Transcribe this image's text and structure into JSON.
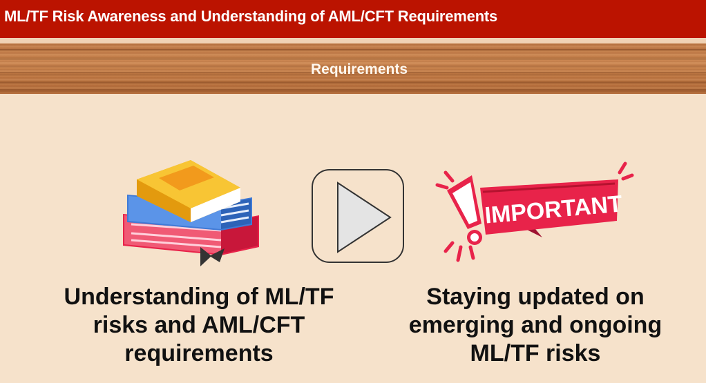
{
  "header": {
    "title": "ML/TF Risk Awareness and Understanding of AML/CFT Requirements"
  },
  "banner": {
    "label": "Requirements"
  },
  "main": {
    "left_caption": "Understanding of ML/TF risks and AML/CFT requirements",
    "right_caption": "Staying updated on emerging and ongoing ML/TF risks",
    "important_label": "IMPORTANT"
  },
  "icons": {
    "books": "book-stack-icon",
    "play": "play-icon",
    "important": "important-badge-icon"
  },
  "colors": {
    "title_bar": "#bb1300",
    "background": "#f6e2cb",
    "important_red": "#e8234a"
  }
}
